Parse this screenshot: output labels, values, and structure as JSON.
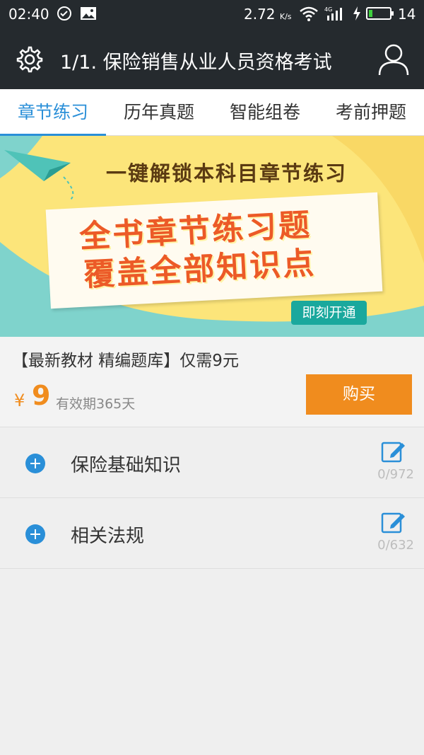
{
  "status_bar": {
    "time": "02:40",
    "speed": "2.72",
    "speed_unit": "K/s",
    "battery": "14",
    "icons": [
      "check-circle-icon",
      "image-icon",
      "wifi-icon",
      "signal-4g-icon",
      "charging-icon",
      "battery-icon"
    ]
  },
  "app_bar": {
    "title": "1/1. 保险销售从业人员资格考试",
    "icons": [
      "gear-icon",
      "user-icon"
    ]
  },
  "tabs": [
    {
      "label": "章节练习",
      "active": true
    },
    {
      "label": "历年真题",
      "active": false
    },
    {
      "label": "智能组卷",
      "active": false
    },
    {
      "label": "考前押题",
      "active": false
    }
  ],
  "banner": {
    "headline": "一键解锁本科目章节练习",
    "line1": "全书章节练习题",
    "line2": "覆盖全部知识点",
    "button": "即刻开通"
  },
  "promo": {
    "desc": "【最新教材 精编题库】仅需9元",
    "currency": "¥",
    "price": "9",
    "validity": "有效期365天",
    "buy_label": "购买"
  },
  "chapters": [
    {
      "name": "保险基础知识",
      "count": "0/972"
    },
    {
      "name": "相关法规",
      "count": "0/632"
    }
  ],
  "colors": {
    "bar_bg": "#252a2e",
    "accent_blue": "#2a8fd8",
    "accent_orange": "#f08c1e",
    "banner_yellow": "#fce57a",
    "banner_teal": "#7fd3cc",
    "banner_red": "#ec5a27"
  }
}
